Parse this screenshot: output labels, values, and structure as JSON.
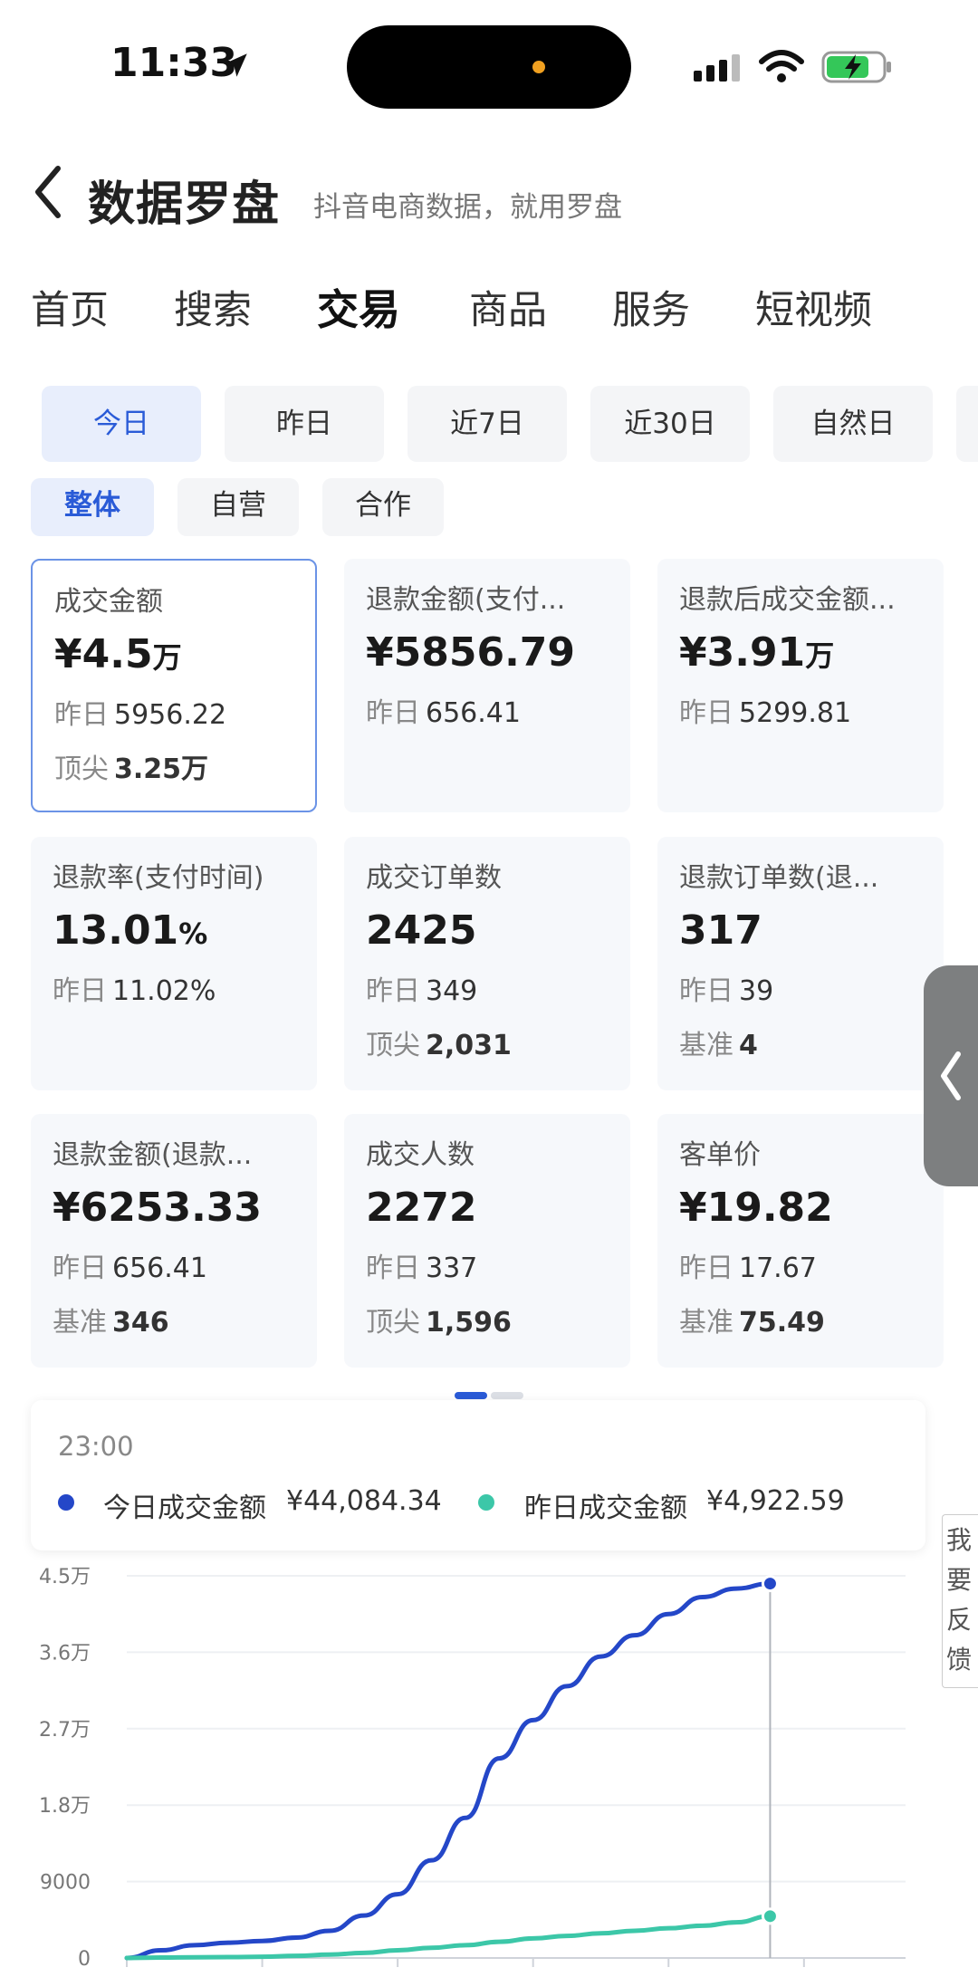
{
  "status": {
    "time": "11:33"
  },
  "header": {
    "back_icon": "chevron-left-icon",
    "title": "数据罗盘",
    "subtitle": "抖音电商数据，就用罗盘"
  },
  "main_tabs": [
    {
      "label": "首页"
    },
    {
      "label": "搜索"
    },
    {
      "label": "交易",
      "active": true
    },
    {
      "label": "商品"
    },
    {
      "label": "服务"
    },
    {
      "label": "短视频"
    }
  ],
  "date_tabs": [
    {
      "label": "今日",
      "active": true
    },
    {
      "label": "昨日"
    },
    {
      "label": "近7日"
    },
    {
      "label": "近30日"
    },
    {
      "label": "自然日"
    }
  ],
  "segments": [
    {
      "label": "整体",
      "active": true
    },
    {
      "label": "自营"
    },
    {
      "label": "合作"
    }
  ],
  "metrics": [
    {
      "label": "成交金额",
      "value": "¥4.5",
      "unit": "万",
      "sub1_k": "昨日",
      "sub1_v": "5956.22",
      "sub2_k": "顶尖",
      "sub2_v": "3.25万"
    },
    {
      "label": "退款金额(支付...",
      "value": "¥5856.79",
      "unit": "",
      "sub1_k": "昨日",
      "sub1_v": "656.41",
      "sub2_k": "",
      "sub2_v": ""
    },
    {
      "label": "退款后成交金额...",
      "value": "¥3.91",
      "unit": "万",
      "sub1_k": "昨日",
      "sub1_v": "5299.81",
      "sub2_k": "",
      "sub2_v": ""
    },
    {
      "label": "退款率(支付时间)",
      "value": "13.01",
      "unit": "%",
      "sub1_k": "昨日",
      "sub1_v": "11.02%",
      "sub2_k": "",
      "sub2_v": ""
    },
    {
      "label": "成交订单数",
      "value": "2425",
      "unit": "",
      "sub1_k": "昨日",
      "sub1_v": "349",
      "sub2_k": "顶尖",
      "sub2_v": "2,031"
    },
    {
      "label": "退款订单数(退...",
      "value": "317",
      "unit": "",
      "sub1_k": "昨日",
      "sub1_v": "39",
      "sub2_k": "基准",
      "sub2_v": "4"
    },
    {
      "label": "退款金额(退款...",
      "value": "¥6253.33",
      "unit": "",
      "sub1_k": "昨日",
      "sub1_v": "656.41",
      "sub2_k": "基准",
      "sub2_v": "346"
    },
    {
      "label": "成交人数",
      "value": "2272",
      "unit": "",
      "sub1_k": "昨日",
      "sub1_v": "337",
      "sub2_k": "顶尖",
      "sub2_v": "1,596"
    },
    {
      "label": "客单价",
      "value": "¥19.82",
      "unit": "",
      "sub1_k": "昨日",
      "sub1_v": "17.67",
      "sub2_k": "基准",
      "sub2_v": "75.49"
    }
  ],
  "tooltip": {
    "time": "23:00",
    "today_label": "今日成交金额",
    "today_value": "¥44,084.34",
    "yesterday_label": "昨日成交金额",
    "yesterday_value": "¥4,922.59"
  },
  "feedback": [
    "我",
    "要",
    "反",
    "馈"
  ],
  "colors": {
    "accent": "#2a5bd7",
    "today_line": "#2447c8",
    "yesterday_line": "#3cc7a8"
  },
  "chart_data": {
    "type": "line",
    "y_ticks": [
      "0",
      "9000",
      "1.8万",
      "2.7万",
      "3.6万",
      "4.5万"
    ],
    "ylim": [
      0,
      45000
    ],
    "x": [
      0,
      1,
      2,
      3,
      4,
      5,
      6,
      7,
      8,
      9,
      10,
      11,
      12,
      13,
      14,
      15,
      16,
      17,
      18,
      19,
      20,
      21,
      22,
      23
    ],
    "series": [
      {
        "name": "今日成交金额",
        "color": "#2447c8",
        "values": [
          0,
          900,
          1500,
          1800,
          2000,
          2400,
          3200,
          5000,
          7500,
          11500,
          16500,
          23500,
          28000,
          32000,
          35500,
          38000,
          40500,
          42500,
          43500,
          44084.34,
          null,
          null,
          null,
          null
        ]
      },
      {
        "name": "昨日成交金额",
        "color": "#3cc7a8",
        "values": [
          0,
          50,
          80,
          100,
          150,
          250,
          400,
          600,
          900,
          1200,
          1500,
          1900,
          2300,
          2600,
          2900,
          3200,
          3500,
          3800,
          4200,
          4922.59,
          null,
          null,
          null,
          null
        ]
      }
    ],
    "grid": true
  }
}
